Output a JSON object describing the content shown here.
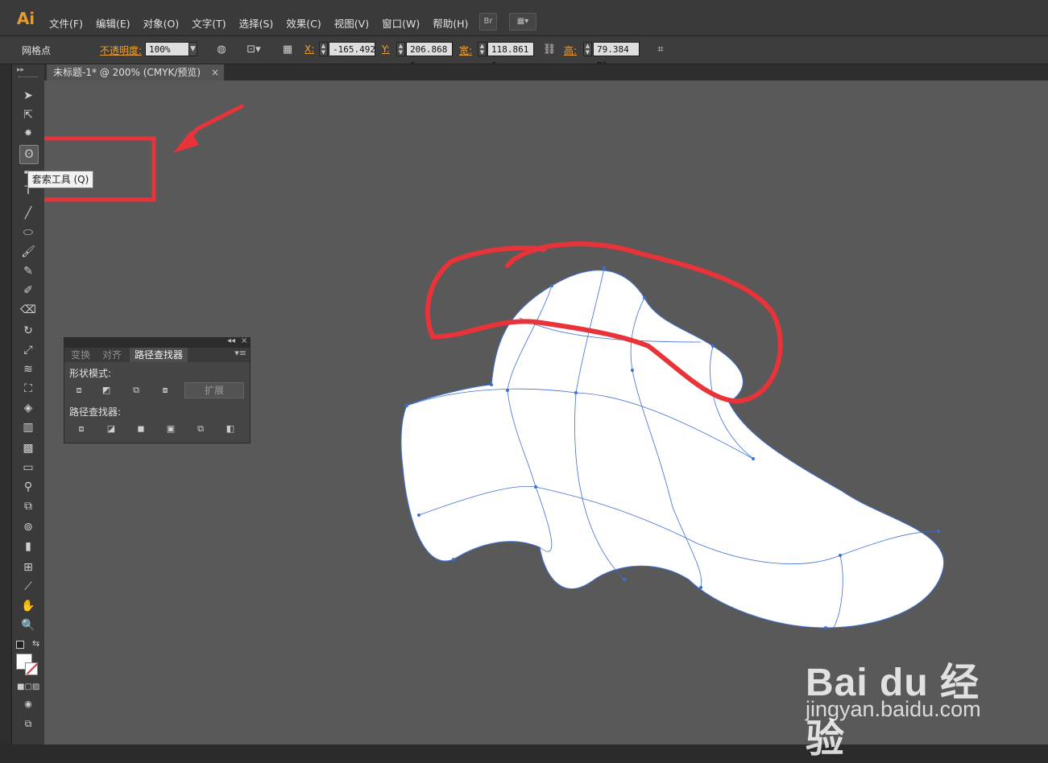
{
  "app": {
    "logo": "Ai"
  },
  "menu": {
    "items": [
      "文件(F)",
      "编辑(E)",
      "对象(O)",
      "文字(T)",
      "选择(S)",
      "效果(C)",
      "视图(V)",
      "窗口(W)",
      "帮助(H)"
    ],
    "bridge_label": "Br"
  },
  "control": {
    "selection_label": "网格点",
    "opacity_label": "不透明度:",
    "opacity_value": "100%",
    "x_label": "X:",
    "x_value": "-165.492",
    "y_label": "Y:",
    "y_value": "206.868 r",
    "w_label": "宽:",
    "w_value": "118.861 r",
    "h_label": "高:",
    "h_value": "79.384 mi"
  },
  "document": {
    "tab_title": "未标题-1* @ 200% (CMYK/预览)",
    "close": "×"
  },
  "tooltip": {
    "text": "套索工具 (Q)"
  },
  "panel": {
    "collapse": "◂◂",
    "close": "×",
    "tabs": [
      "变换",
      "对齐",
      "路径查找器"
    ],
    "active_tab": "路径查找器",
    "menu": "▾≡",
    "shape_modes_label": "形状模式:",
    "expand_label": "扩展",
    "pathfinders_label": "路径查找器:"
  },
  "watermark": {
    "brand": "Bai du 经验",
    "url": "jingyan.baidu.com"
  },
  "colors": {
    "accent": "#e59b2d",
    "annotation": "#e8333a",
    "canvas": "#595959",
    "mesh": "#3d6fd6"
  }
}
